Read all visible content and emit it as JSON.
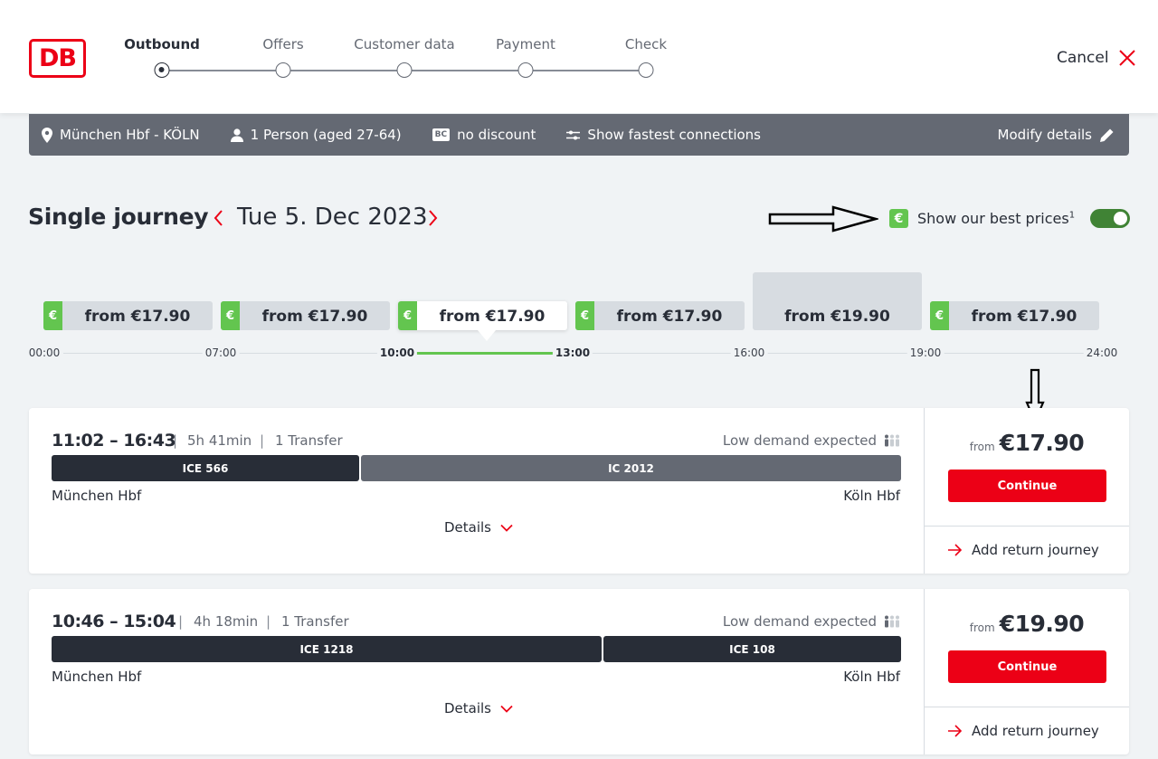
{
  "logo": {
    "text": "DB"
  },
  "steps": [
    {
      "label": "Outbound",
      "active": true
    },
    {
      "label": "Offers",
      "active": false
    },
    {
      "label": "Customer data",
      "active": false
    },
    {
      "label": "Payment",
      "active": false
    },
    {
      "label": "Check",
      "active": false
    }
  ],
  "header": {
    "cancel_label": "Cancel"
  },
  "summary": {
    "route": "München Hbf - KÖLN",
    "passengers": "1 Person (aged 27-64)",
    "bc_badge": "BC",
    "discount": "no discount",
    "connections": "Show fastest connections",
    "modify": "Modify details"
  },
  "journey": {
    "title": "Single journey",
    "date": "Tue 5. Dec 2023",
    "best_prices_label": "Show our best prices",
    "best_prices_sup": "1",
    "best_prices_enabled": true,
    "euro_symbol": "€"
  },
  "slots": [
    {
      "price": "from €17.90",
      "best": true,
      "active": false
    },
    {
      "price": "from €17.90",
      "best": true,
      "active": false
    },
    {
      "price": "from €17.90",
      "best": true,
      "active": true
    },
    {
      "price": "from €17.90",
      "best": true,
      "active": false
    },
    {
      "price": "from €19.90",
      "best": false,
      "active": false
    },
    {
      "price": "from €17.90",
      "best": true,
      "active": false
    }
  ],
  "timeline": [
    "00:00",
    "07:00",
    "10:00",
    "13:00",
    "16:00",
    "19:00",
    "24:00"
  ],
  "connections": [
    {
      "times": "11:02 – 16:43",
      "duration": "5h 41min",
      "transfers": "1 Transfer",
      "demand": "Low demand expected",
      "segments": [
        {
          "name": "ICE 566",
          "style": "dark"
        },
        {
          "name": "IC 2012",
          "style": "grey"
        }
      ],
      "from_station": "München Hbf",
      "to_station": "Köln Hbf",
      "details": "Details",
      "price_from": "from",
      "price": "€17.90",
      "continue": "Continue",
      "add_return": "Add return journey"
    },
    {
      "times": "10:46 – 15:04",
      "duration": "4h 18min",
      "transfers": "1 Transfer",
      "demand": "Low demand expected",
      "segments": [
        {
          "name": "ICE 1218",
          "style": "dark"
        },
        {
          "name": "ICE 108",
          "style": "dark"
        }
      ],
      "from_station": "München Hbf",
      "to_station": "Köln Hbf",
      "details": "Details",
      "price_from": "from",
      "price": "€19.90",
      "continue": "Continue",
      "add_return": "Add return journey"
    }
  ],
  "colors": {
    "brand_red": "#ec0016",
    "best_green": "#63c54f",
    "toggle_green": "#408335",
    "summary_grey": "#646973"
  }
}
